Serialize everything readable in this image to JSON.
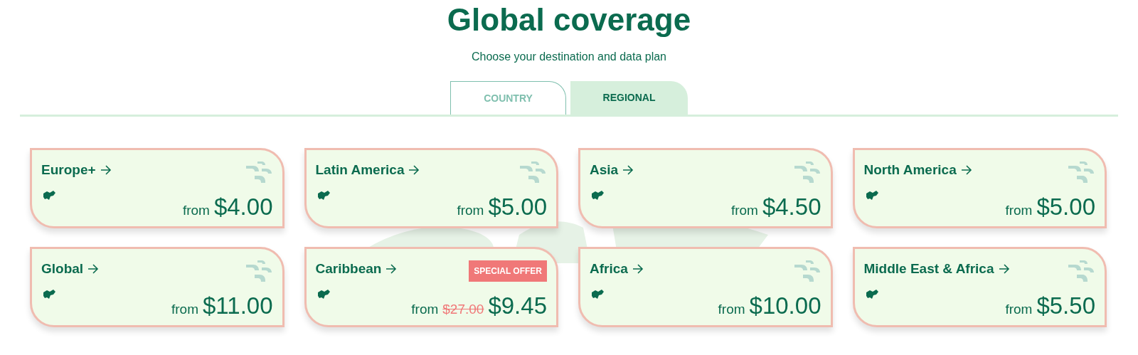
{
  "title": "Global coverage",
  "subtitle": "Choose your destination and data plan",
  "tabs": [
    {
      "label": "COUNTRY",
      "selected": false
    },
    {
      "label": "REGIONAL",
      "selected": true
    }
  ],
  "regions": [
    {
      "name": "Europe+",
      "from": "from",
      "price": "$4.00"
    },
    {
      "name": "Latin America",
      "from": "from",
      "price": "$5.00"
    },
    {
      "name": "Asia",
      "from": "from",
      "price": "$4.50"
    },
    {
      "name": "North America",
      "from": "from",
      "price": "$5.00"
    },
    {
      "name": "Global",
      "from": "from",
      "price": "$11.00"
    },
    {
      "name": "Caribbean",
      "from": "from",
      "price": "$9.45",
      "old_price": "$27.00",
      "badge": "SPECIAL OFFER"
    },
    {
      "name": "Africa",
      "from": "from",
      "price": "$10.00"
    },
    {
      "name": "Middle East & Africa",
      "from": "from",
      "price": "$5.50"
    }
  ]
}
